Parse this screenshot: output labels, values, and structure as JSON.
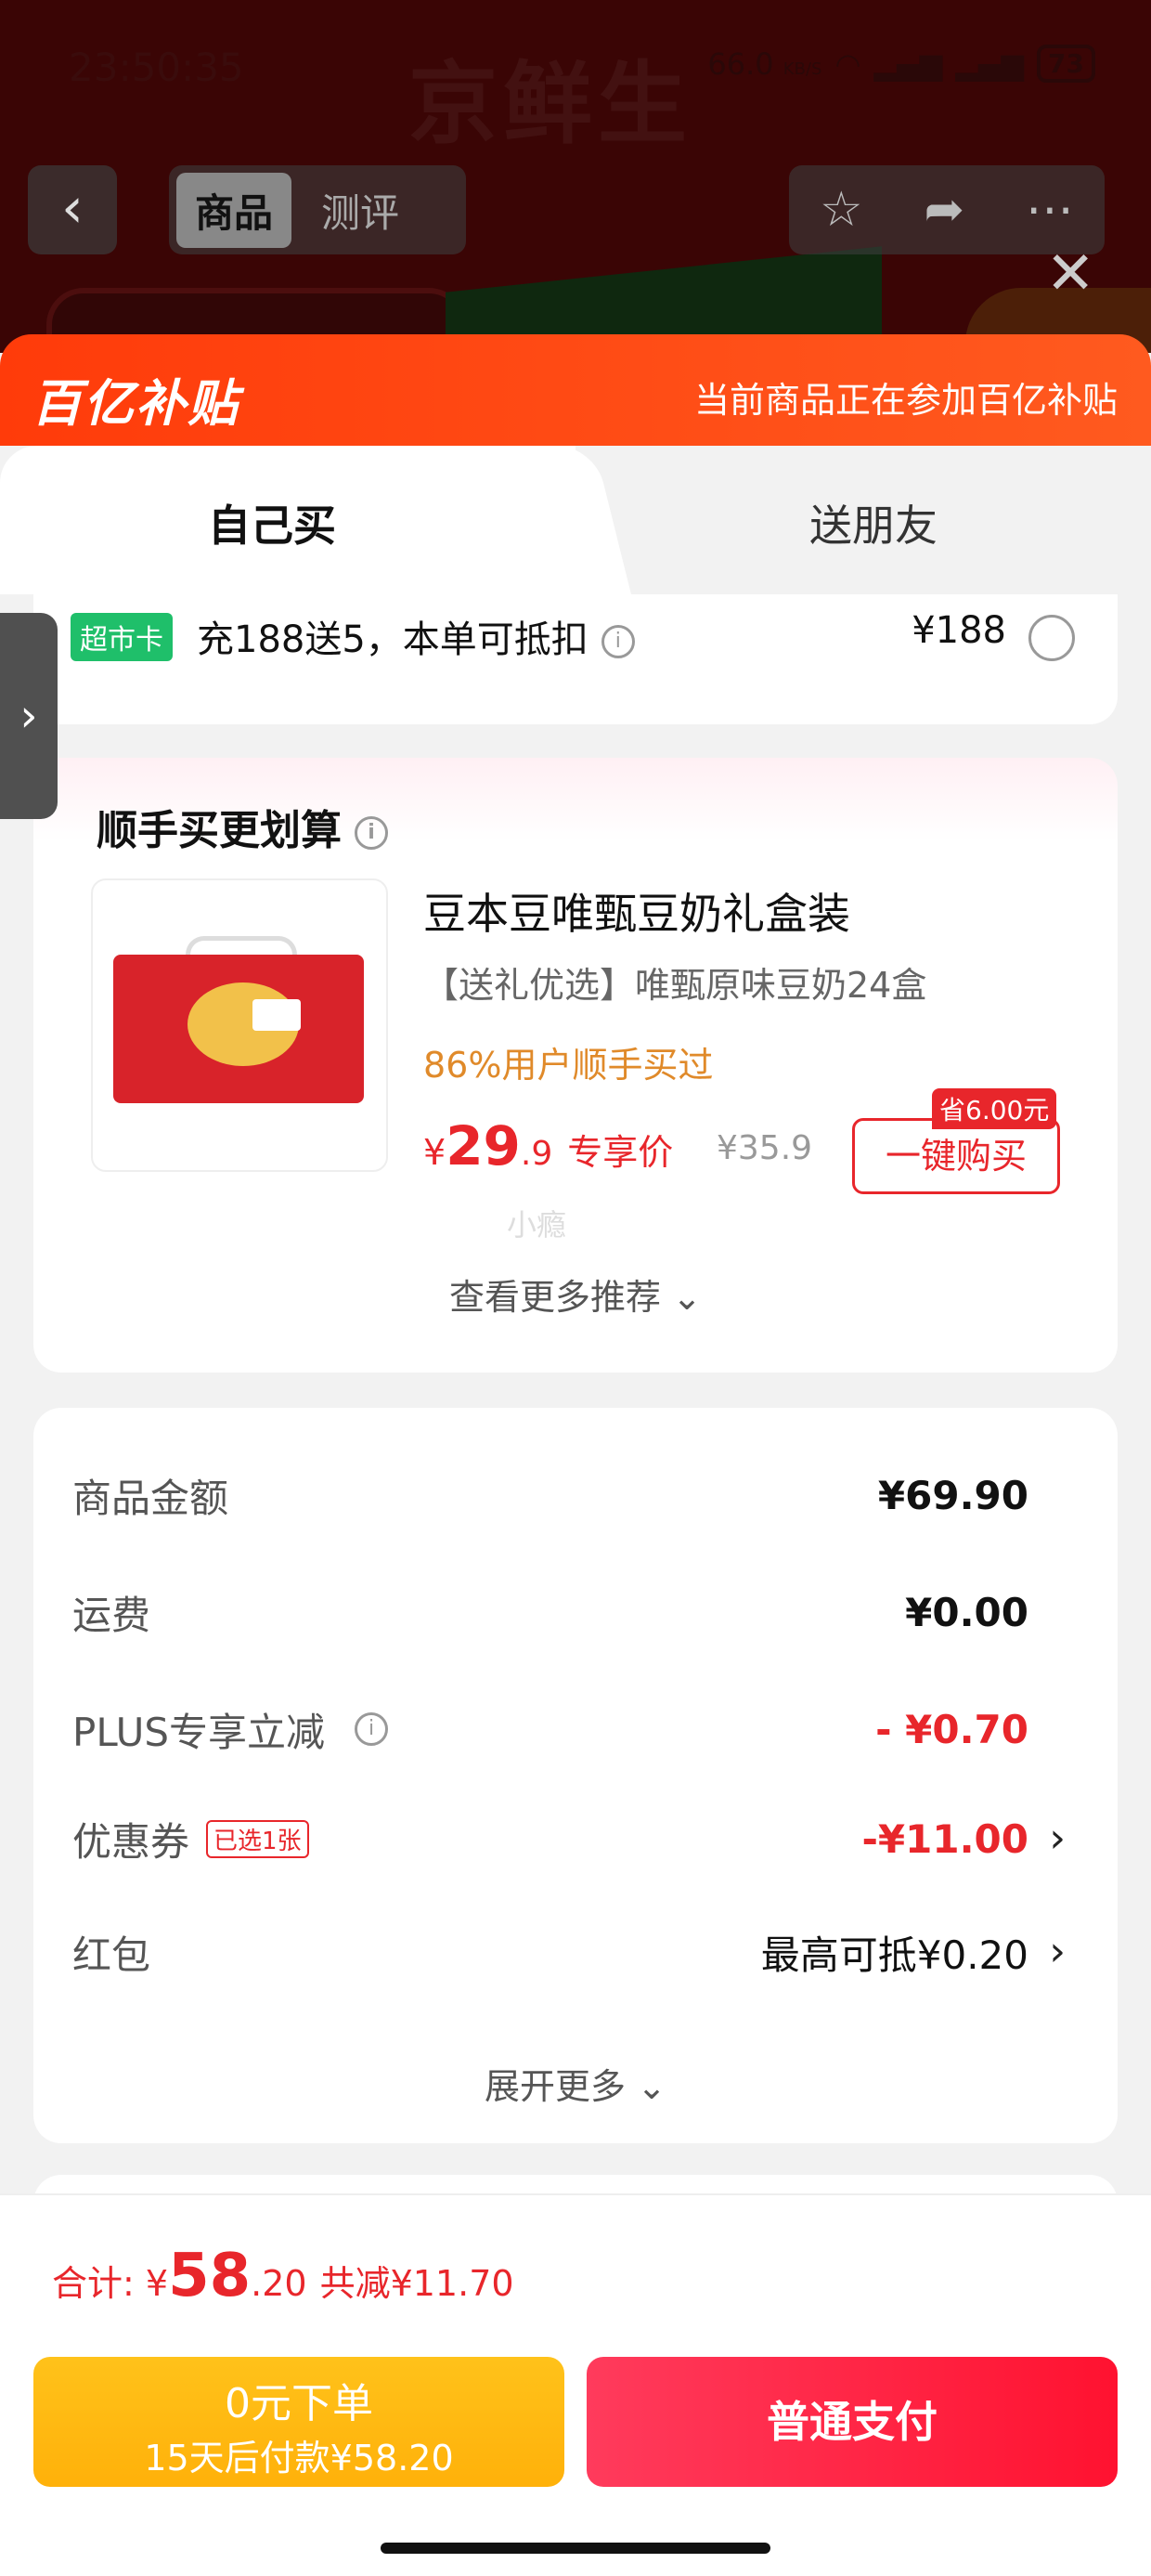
{
  "status_bar": {
    "time": "23:50:35",
    "net_speed": "66.0",
    "net_unit": "KB/S",
    "battery": "73"
  },
  "background": {
    "brand": "京鲜生",
    "tabs": [
      "商品",
      "测评"
    ],
    "active_tab": "商品"
  },
  "bybt": {
    "logo": "百亿补贴",
    "notice": "当前商品正在参加百亿补贴"
  },
  "tabs": {
    "self": "自己买",
    "friend": "送朋友"
  },
  "cash_card": {
    "badge": "超市卡",
    "text": "充188送5，本单可抵扣",
    "amount": "¥188"
  },
  "upsell": {
    "title": "顺手买更划算",
    "product_name": "豆本豆唯甄豆奶礼盒装",
    "product_sub": "【送礼优选】唯甄原味豆奶24盒",
    "popularity": "86%用户顺手买过",
    "price_symbol": "¥",
    "price_int": "29",
    "price_dec": ".9",
    "price_label": "专享价",
    "orig_price": "¥35.9",
    "save_tag": "省6.00元",
    "buy_button": "一键购买",
    "watermark": "小瘾",
    "more": "查看更多推荐 ⌄"
  },
  "summary": {
    "goods_label": "商品金额",
    "goods_value": "¥69.90",
    "shipping_label": "运费",
    "shipping_value": "¥0.00",
    "plus_label": "PLUS专享立减",
    "plus_value": "- ¥0.70",
    "coupon_label": "优惠券",
    "coupon_tag": "已选1张",
    "coupon_value": "-¥11.00",
    "hongbao_label": "红包",
    "hongbao_value": "最高可抵¥0.20",
    "expand": "展开更多 ⌄"
  },
  "footer": {
    "total_label": "合计: ",
    "total_symbol": "¥",
    "total_int": "58",
    "total_dec": ".20",
    "discount": "共减¥11.70",
    "pay_later_title": "0元下单",
    "pay_later_sub": "15天后付款¥58.20",
    "pay_now": "普通支付"
  },
  "colors": {
    "accent_red": "#e8262b",
    "bybt_orange": "#ff3b0a",
    "pay_later": "#ffb10a",
    "pay_now": "#ff1230"
  }
}
